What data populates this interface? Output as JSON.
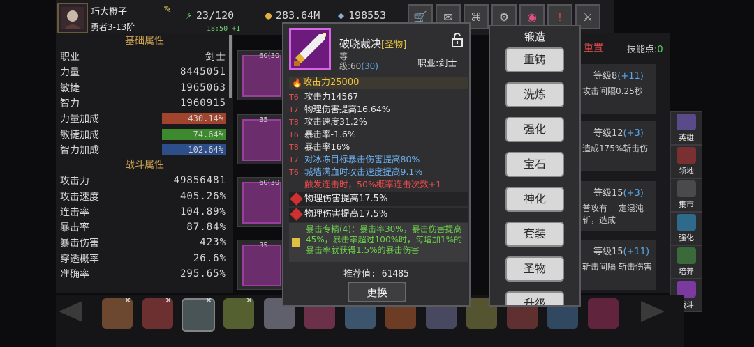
{
  "player": {
    "name": "巧大橙子",
    "rank": "勇者3-13阶"
  },
  "resources": {
    "energy": "23/120",
    "energy_timer": "18:50 +1",
    "gold": "283.64M",
    "gems": "198553"
  },
  "toolbar_icons": [
    "shop-icon",
    "mail-icon",
    "gamepad-icon",
    "gear-icon",
    "color-wheel-icon",
    "alert-icon",
    "swords-icon"
  ],
  "stats": {
    "basic_title": "基础属性",
    "basic": [
      {
        "label": "职业",
        "value": "剑士"
      },
      {
        "label": "力量",
        "value": "8445051"
      },
      {
        "label": "敏捷",
        "value": "1965063"
      },
      {
        "label": "智力",
        "value": "1960915"
      }
    ],
    "bonus": [
      {
        "label": "力量加成",
        "value": "430.14%",
        "color": "#a0442e"
      },
      {
        "label": "敏捷加成",
        "value": "74.64%",
        "color": "#3d8a2e"
      },
      {
        "label": "智力加成",
        "value": "102.64%",
        "color": "#2e4e8a"
      }
    ],
    "combat_title": "战斗属性",
    "combat": [
      {
        "label": "攻击力",
        "value": "49856481"
      },
      {
        "label": "攻击速度",
        "value": "405.26%"
      },
      {
        "label": "连击率",
        "value": "104.89%"
      },
      {
        "label": "暴击率",
        "value": "87.84%"
      },
      {
        "label": "暴击伤害",
        "value": "423%"
      },
      {
        "label": "穿透概率",
        "value": "26.6%"
      },
      {
        "label": "准确率",
        "value": "295.65%"
      }
    ]
  },
  "gear_list": [
    {
      "level": "60(30"
    },
    {
      "level": "35"
    },
    {
      "level": "60(30"
    },
    {
      "level": "35"
    }
  ],
  "skills": {
    "reset": "重置",
    "points_label": "技能点:",
    "points": "0",
    "cards": [
      {
        "level": "等级8",
        "plus": "(+11)",
        "desc": "攻击间隔0.25秒"
      },
      {
        "level": "等级12",
        "plus": "(+3)",
        "desc": "造成175%斩击伤"
      },
      {
        "level": "等级15",
        "plus": "(+3)",
        "desc": "普攻有 一定混沌斩，造成"
      },
      {
        "level": "等级15",
        "plus": "(+11)",
        "desc": "斩击间隔 斩击伤害"
      }
    ]
  },
  "side_menu": [
    {
      "label": "英雄",
      "color": "#5a4a8a"
    },
    {
      "label": "领地",
      "color": "#7a3030"
    },
    {
      "label": "集市",
      "color": "#4a4a4a"
    },
    {
      "label": "强化",
      "color": "#2e6a8a"
    },
    {
      "label": "培养",
      "color": "#3a6a3a"
    },
    {
      "label": "战斗",
      "color": "#7a3aa0"
    }
  ],
  "item": {
    "name": "破晓裁决",
    "tag": "[圣物]",
    "grade_prefix": "等",
    "grade_line": "级:60",
    "grade_extra": "(30)",
    "class": "职业:剑士",
    "main_attr": "攻击力25000",
    "affixes": [
      {
        "tier": "T6",
        "text": "攻击力14567",
        "style": "normal"
      },
      {
        "tier": "T7",
        "text": "物理伤害提高16.64%",
        "style": "normal"
      },
      {
        "tier": "T8",
        "text": "攻击速度31.2%",
        "style": "normal"
      },
      {
        "tier": "T6",
        "text": "暴击率-1.6%",
        "style": "normal"
      },
      {
        "tier": "T8",
        "text": "暴击率16%",
        "style": "normal"
      },
      {
        "tier": "T7",
        "text": "对冰冻目标暴击伤害提高80%",
        "style": "blue"
      },
      {
        "tier": "T6",
        "text": "城墙满血时攻击速度提高9.1%",
        "style": "blue"
      },
      {
        "tier": "",
        "text": "触发连击时，50%概率连击次数+1",
        "style": "red"
      }
    ],
    "gems": [
      "物理伤害提高17.5%",
      "物理伤害提高17.5%"
    ],
    "set_bonus": "暴击专精(4)：暴击率30%，暴击伤害提高45%，暴击率超过100%时，每增加1%的暴击率就获得1.5%的暴击伤害",
    "recommend": "推荐值: 61485",
    "replace_button": "更换"
  },
  "forge": {
    "title": "锻造",
    "buttons": [
      "重铸",
      "洗炼",
      "强化",
      "宝石",
      "神化",
      "套装",
      "圣物",
      "升级"
    ]
  }
}
